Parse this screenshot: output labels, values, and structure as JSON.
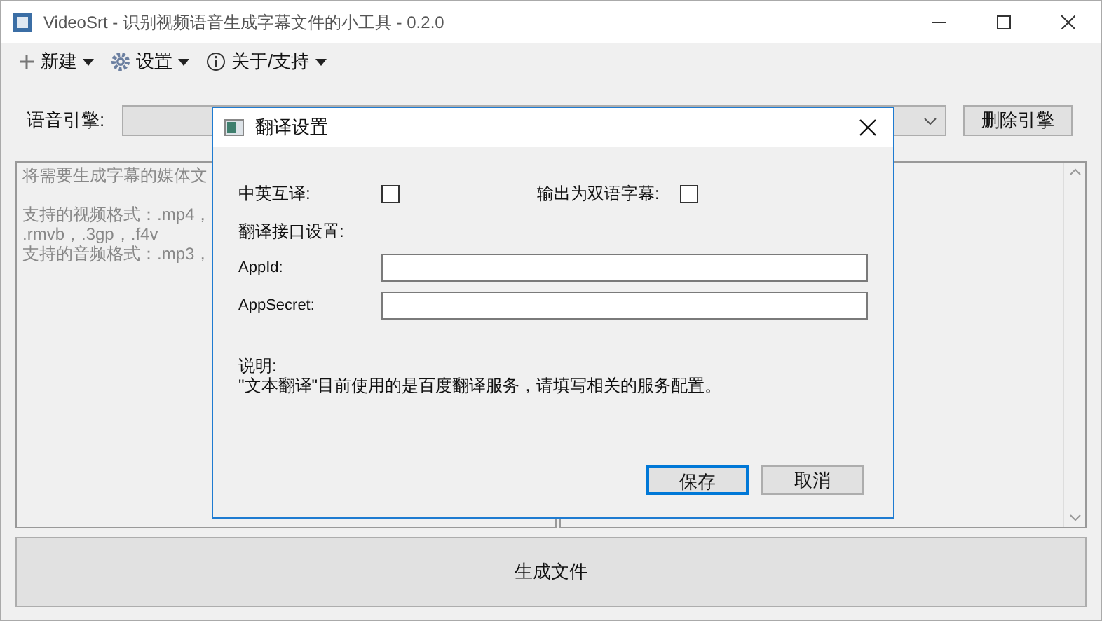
{
  "window": {
    "title": "VideoSrt - 识别视频语音生成字幕文件的小工具 - 0.2.0"
  },
  "menu": [
    {
      "label": "新建"
    },
    {
      "label": "设置"
    },
    {
      "label": "关于/支持"
    }
  ],
  "engine": {
    "label": "语音引擎:",
    "delete_button": "删除引擎"
  },
  "media_panel": {
    "lines": [
      "将需要生成字幕的媒体文",
      "支持的视频格式：.mp4，",
      ".rmvb，.3gp，.f4v",
      "支持的音频格式：.mp3，"
    ]
  },
  "generate_button": "生成文件",
  "dialog": {
    "title": "翻译设置",
    "options": [
      {
        "label": "中英互译:",
        "checked": false
      },
      {
        "label": "输出为双语字幕:",
        "checked": false
      }
    ],
    "section": "翻译接口设置:",
    "fields": [
      {
        "label": "AppId:"
      },
      {
        "label": "AppSecret:"
      }
    ],
    "note_title": "说明:",
    "note": "\"文本翻译\"目前使用的是百度翻译服务，请填写相关的服务配置。",
    "buttons": [
      {
        "label": "保存",
        "selected": true
      },
      {
        "label": "取消",
        "selected": false
      }
    ]
  }
}
